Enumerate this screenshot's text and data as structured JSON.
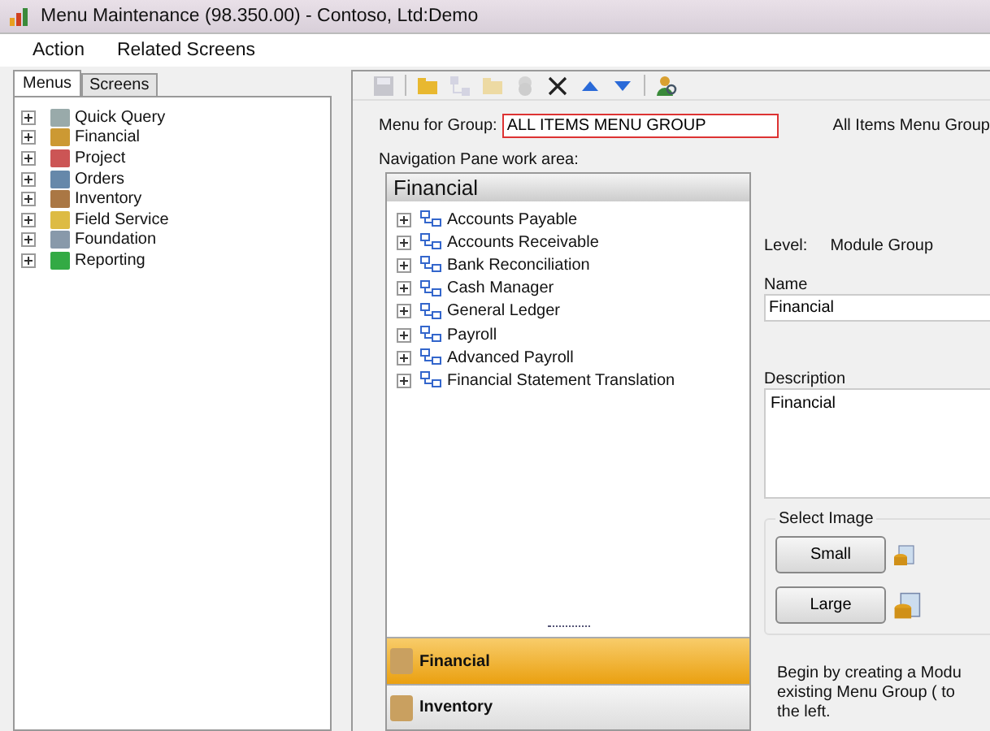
{
  "window": {
    "title": "Menu Maintenance (98.350.00) - Contoso, Ltd:Demo"
  },
  "menu_bar": [
    "Action",
    "Related Screens"
  ],
  "left_tabs": [
    {
      "label": "Menus",
      "selected": true
    },
    {
      "label": "Screens",
      "selected": false
    }
  ],
  "menu_tree": [
    {
      "label": "Quick Query",
      "expanded": false
    },
    {
      "label": "Financial",
      "expanded": false
    },
    {
      "label": "Project",
      "expanded": false
    },
    {
      "label": "Orders",
      "expanded": false
    },
    {
      "label": "Inventory",
      "expanded": false
    },
    {
      "label": "Field Service",
      "expanded": false
    },
    {
      "label": "Foundation",
      "expanded": false
    },
    {
      "label": "Reporting",
      "expanded": false
    }
  ],
  "toolbar": [
    {
      "kind": "save",
      "disabled": true
    },
    {
      "kind": "sep"
    },
    {
      "kind": "folder",
      "disabled": false
    },
    {
      "kind": "nodes",
      "disabled": true
    },
    {
      "kind": "folder",
      "disabled": true
    },
    {
      "kind": "coins",
      "disabled": true
    },
    {
      "kind": "delete",
      "disabled": false
    },
    {
      "kind": "up",
      "disabled": false
    },
    {
      "kind": "down",
      "disabled": false
    },
    {
      "kind": "sep"
    },
    {
      "kind": "user-search",
      "disabled": false
    }
  ],
  "menu_for_group": {
    "label": "Menu for Group:",
    "value": "ALL ITEMS MENU GROUP",
    "description": "All Items Menu Group"
  },
  "nav_pane": {
    "label": "Navigation Pane work area:",
    "header": "Financial",
    "items": [
      {
        "label": "Accounts Payable",
        "expanded": false
      },
      {
        "label": "Accounts Receivable",
        "expanded": false
      },
      {
        "label": "Bank Reconciliation",
        "expanded": false
      },
      {
        "label": "Cash Manager",
        "expanded": false
      },
      {
        "label": "General Ledger",
        "expanded": false
      },
      {
        "label": "Payroll",
        "expanded": false
      },
      {
        "label": "Advanced Payroll",
        "expanded": false
      },
      {
        "label": "Financial Statement Translation",
        "expanded": false
      }
    ],
    "modules": [
      {
        "label": "Financial",
        "selected": true
      },
      {
        "label": "Inventory",
        "selected": false
      }
    ]
  },
  "details": {
    "level_label": "Level:",
    "level_value": "Module Group",
    "name_label": "Name",
    "name_value": "Financial",
    "description_label": "Description",
    "description_value": "Financial",
    "select_image": {
      "title": "Select Image",
      "buttons": [
        "Small",
        "Large"
      ]
    },
    "hint": "Begin by creating a Modu\nexisting Menu Group ( to\nthe left."
  }
}
